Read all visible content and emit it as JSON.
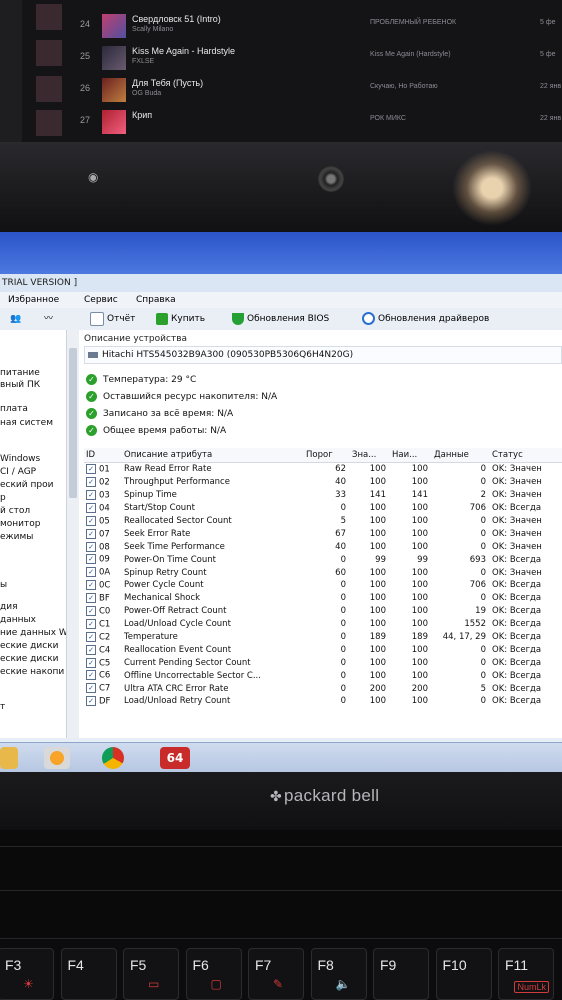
{
  "playlist": {
    "tracks": [
      {
        "num": "24",
        "title": "Свердловск 51 (Intro)",
        "artist": "Scally Milano",
        "album": "ПРОБЛЕМНЫЙ РЕБЕНОК",
        "added": "5 фе"
      },
      {
        "num": "25",
        "title": "Kiss Me Again - Hardstyle",
        "artist": "FXLSE",
        "album": "Kiss Me Again (Hardstyle)",
        "added": "5 фе"
      },
      {
        "num": "26",
        "title": "Для Тебя (Пусть)",
        "artist": "OG Buda",
        "album": "Скучаю, Но Работаю",
        "added": "22 янв"
      },
      {
        "num": "27",
        "title": "Крип",
        "artist": "",
        "album": "РОК МИКС",
        "added": "22 янв"
      }
    ]
  },
  "window": {
    "title": "TRIAL VERSION ]",
    "menu": [
      "Избранное",
      "Сервис",
      "Справка"
    ]
  },
  "toolbar": {
    "report": "Отчёт",
    "buy": "Купить",
    "bios_updates": "Обновления BIOS",
    "driver_updates": "Обновления драйверов"
  },
  "left_tree": [
    "питание",
    "вный ПК",
    "плата",
    "ная систем",
    "",
    "Windows",
    "CI / AGP",
    "еский прои",
    "р",
    "й стол",
    "монитор",
    "ежимы",
    "",
    "",
    "ы",
    "дия",
    "данных",
    "ние данных W",
    "еские диски",
    "еские диски",
    "еские накопи",
    "",
    "",
    "т"
  ],
  "device": {
    "section_label": "Описание устройства",
    "name": "Hitachi HTS545032B9A300 (090530PB5306Q6H4N20G)"
  },
  "status_lines": [
    "Температура: 29 °C",
    "Оставшийся ресурс накопителя: N/A",
    "Записано за всё время: N/A",
    "Общее время работы: N/A"
  ],
  "smart": {
    "headers": [
      "ID",
      "Описание атрибута",
      "Порог",
      "Зна...",
      "Наи...",
      "Данные",
      "Статус"
    ],
    "rows": [
      {
        "id": "01",
        "name": "Raw Read Error Rate",
        "threshold": "62",
        "value": "100",
        "worst": "100",
        "data": "0",
        "status": "OK: Значен"
      },
      {
        "id": "02",
        "name": "Throughput Performance",
        "threshold": "40",
        "value": "100",
        "worst": "100",
        "data": "0",
        "status": "OK: Значен"
      },
      {
        "id": "03",
        "name": "Spinup Time",
        "threshold": "33",
        "value": "141",
        "worst": "141",
        "data": "2",
        "status": "OK: Значен"
      },
      {
        "id": "04",
        "name": "Start/Stop Count",
        "threshold": "0",
        "value": "100",
        "worst": "100",
        "data": "706",
        "status": "OK: Всегда"
      },
      {
        "id": "05",
        "name": "Reallocated Sector Count",
        "threshold": "5",
        "value": "100",
        "worst": "100",
        "data": "0",
        "status": "OK: Значен"
      },
      {
        "id": "07",
        "name": "Seek Error Rate",
        "threshold": "67",
        "value": "100",
        "worst": "100",
        "data": "0",
        "status": "OK: Значен"
      },
      {
        "id": "08",
        "name": "Seek Time Performance",
        "threshold": "40",
        "value": "100",
        "worst": "100",
        "data": "0",
        "status": "OK: Значен"
      },
      {
        "id": "09",
        "name": "Power-On Time Count",
        "threshold": "0",
        "value": "99",
        "worst": "99",
        "data": "693",
        "status": "OK: Всегда"
      },
      {
        "id": "0A",
        "name": "Spinup Retry Count",
        "threshold": "60",
        "value": "100",
        "worst": "100",
        "data": "0",
        "status": "OK: Значен"
      },
      {
        "id": "0C",
        "name": "Power Cycle Count",
        "threshold": "0",
        "value": "100",
        "worst": "100",
        "data": "706",
        "status": "OK: Всегда"
      },
      {
        "id": "BF",
        "name": "Mechanical Shock",
        "threshold": "0",
        "value": "100",
        "worst": "100",
        "data": "0",
        "status": "OK: Всегда"
      },
      {
        "id": "C0",
        "name": "Power-Off Retract Count",
        "threshold": "0",
        "value": "100",
        "worst": "100",
        "data": "19",
        "status": "OK: Всегда"
      },
      {
        "id": "C1",
        "name": "Load/Unload Cycle Count",
        "threshold": "0",
        "value": "100",
        "worst": "100",
        "data": "1552",
        "status": "OK: Всегда"
      },
      {
        "id": "C2",
        "name": "Temperature",
        "threshold": "0",
        "value": "189",
        "worst": "189",
        "data": "44, 17, 29",
        "status": "OK: Всегда"
      },
      {
        "id": "C4",
        "name": "Reallocation Event Count",
        "threshold": "0",
        "value": "100",
        "worst": "100",
        "data": "0",
        "status": "OK: Всегда"
      },
      {
        "id": "C5",
        "name": "Current Pending Sector Count",
        "threshold": "0",
        "value": "100",
        "worst": "100",
        "data": "0",
        "status": "OK: Всегда"
      },
      {
        "id": "C6",
        "name": "Offline Uncorrectable Sector C...",
        "threshold": "0",
        "value": "100",
        "worst": "100",
        "data": "0",
        "status": "OK: Всегда"
      },
      {
        "id": "C7",
        "name": "Ultra ATA CRC Error Rate",
        "threshold": "0",
        "value": "200",
        "worst": "200",
        "data": "5",
        "status": "OK: Всегда"
      },
      {
        "id": "DF",
        "name": "Load/Unload Retry Count",
        "threshold": "0",
        "value": "100",
        "worst": "100",
        "data": "0",
        "status": "OK: Всегда"
      }
    ]
  },
  "taskbar": {
    "aida_label": "64"
  },
  "laptop": {
    "brand": "packard bell"
  },
  "keys": [
    {
      "label": "F3",
      "sub": "☀"
    },
    {
      "label": "F4",
      "sub": ""
    },
    {
      "label": "F5",
      "sub": "▭"
    },
    {
      "label": "F6",
      "sub": "▢"
    },
    {
      "label": "F7",
      "sub": "✎"
    },
    {
      "label": "F8",
      "sub": "🔈"
    },
    {
      "label": "F9",
      "sub": ""
    },
    {
      "label": "F10",
      "sub": ""
    },
    {
      "label": "F11",
      "sub": ""
    }
  ],
  "numlk_label": "NumLk",
  "colors": {
    "ok_green": "#2ca02c",
    "titlebar_blue": "#2b55c8",
    "key_accent": "#d13b3b"
  }
}
